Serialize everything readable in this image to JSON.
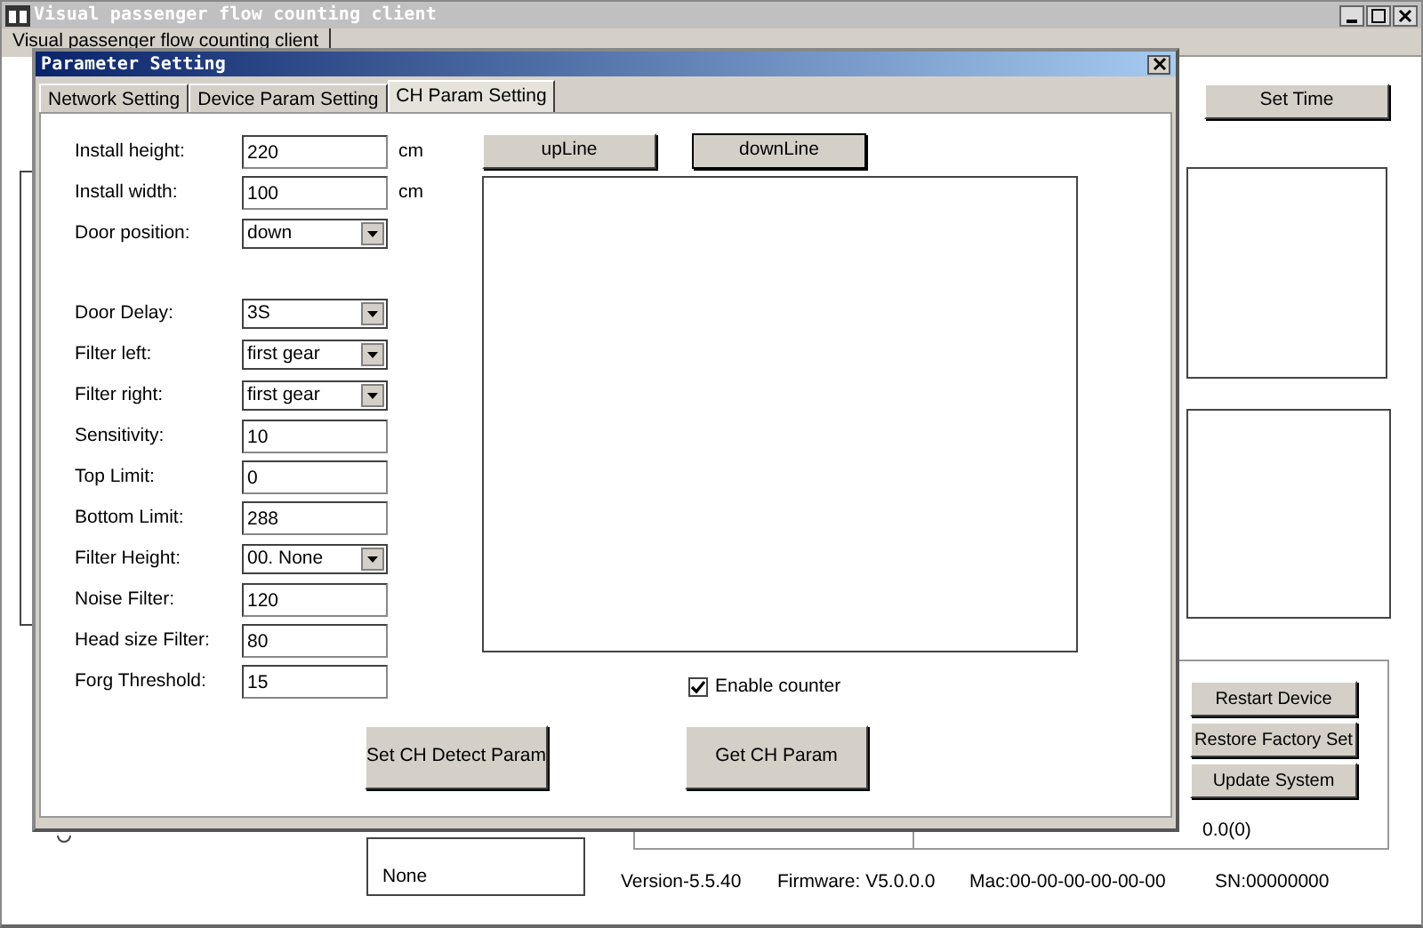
{
  "main_window": {
    "title": "Visual passenger flow counting client",
    "tab": "Visual passenger flow counting client",
    "set_time_button": "Set Time",
    "device_buttons": [
      "Restart Device",
      "Restore Factory Set",
      "Update System"
    ],
    "progress_text": "0.0(0)",
    "list_value": "None",
    "status_bar": [
      "Version-5.5.40",
      "Firmware: V5.0.0.0",
      "Mac:00-00-00-00-00-00",
      "SN:00000000"
    ]
  },
  "dialog": {
    "title": "Parameter Setting",
    "tabs": [
      {
        "label": "Network Setting",
        "selected": false
      },
      {
        "label": "Device Param Setting",
        "selected": false
      },
      {
        "label": "CH Param Setting",
        "selected": true
      }
    ],
    "fields": [
      {
        "label": "Install height:",
        "kind": "text",
        "value": "220",
        "unit": "cm"
      },
      {
        "label": "Install width:",
        "kind": "text",
        "value": "100",
        "unit": "cm"
      },
      {
        "label": "Door position:",
        "kind": "select",
        "value": "down"
      },
      {
        "label": "Door Delay:",
        "kind": "select",
        "value": "3S"
      },
      {
        "label": "Filter left:",
        "kind": "select",
        "value": "first gear"
      },
      {
        "label": "Filter right:",
        "kind": "select",
        "value": "first gear"
      },
      {
        "label": "Sensitivity:",
        "kind": "text",
        "value": "10"
      },
      {
        "label": "Top Limit:",
        "kind": "text",
        "value": "0"
      },
      {
        "label": "Bottom Limit:",
        "kind": "text",
        "value": "288"
      },
      {
        "label": "Filter Height:",
        "kind": "select",
        "value": "00. None"
      },
      {
        "label": "Noise Filter:",
        "kind": "text",
        "value": "120"
      },
      {
        "label": "Head size Filter:",
        "kind": "text",
        "value": "80"
      },
      {
        "label": "Forg Threshold:",
        "kind": "text",
        "value": "15"
      }
    ],
    "line_buttons": [
      {
        "label": "upLine",
        "focused": false
      },
      {
        "label": "downLine",
        "focused": true
      }
    ],
    "enable_counter": {
      "label": "Enable counter",
      "checked": true
    },
    "action_buttons": [
      "Set CH Detect Param",
      "Get CH Param"
    ]
  }
}
